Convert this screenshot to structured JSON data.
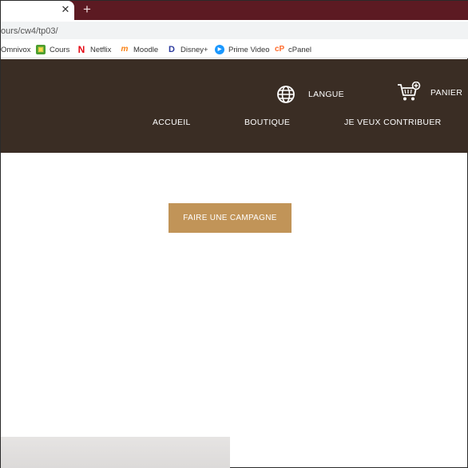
{
  "browser": {
    "tab_close_glyph": "✕",
    "new_tab_glyph": "+",
    "url": "ours/cw4/tp03/",
    "bookmarks": [
      {
        "label": "Omnivox",
        "icon": ""
      },
      {
        "label": "Cours",
        "icon": "cours-icon"
      },
      {
        "label": "Netflix",
        "icon": "netflix-icon"
      },
      {
        "label": "Moodle",
        "icon": "moodle-icon"
      },
      {
        "label": "Disney+",
        "icon": "disney-icon"
      },
      {
        "label": "Prime Video",
        "icon": "prime-video-icon"
      },
      {
        "label": "cPanel",
        "icon": "cpanel-icon"
      }
    ]
  },
  "header": {
    "language_label": "LANGUE",
    "cart_label": "PANIER",
    "nav": [
      {
        "label": "ACCUEIL"
      },
      {
        "label": "BOUTIQUE"
      },
      {
        "label": "JE VEUX CONTRIBUER"
      }
    ],
    "colors": {
      "background": "#3a2d24",
      "text": "#ffffff"
    }
  },
  "main": {
    "cta_label": "FAIRE UNE CAMPAGNE",
    "cta_color": "#c19458"
  }
}
